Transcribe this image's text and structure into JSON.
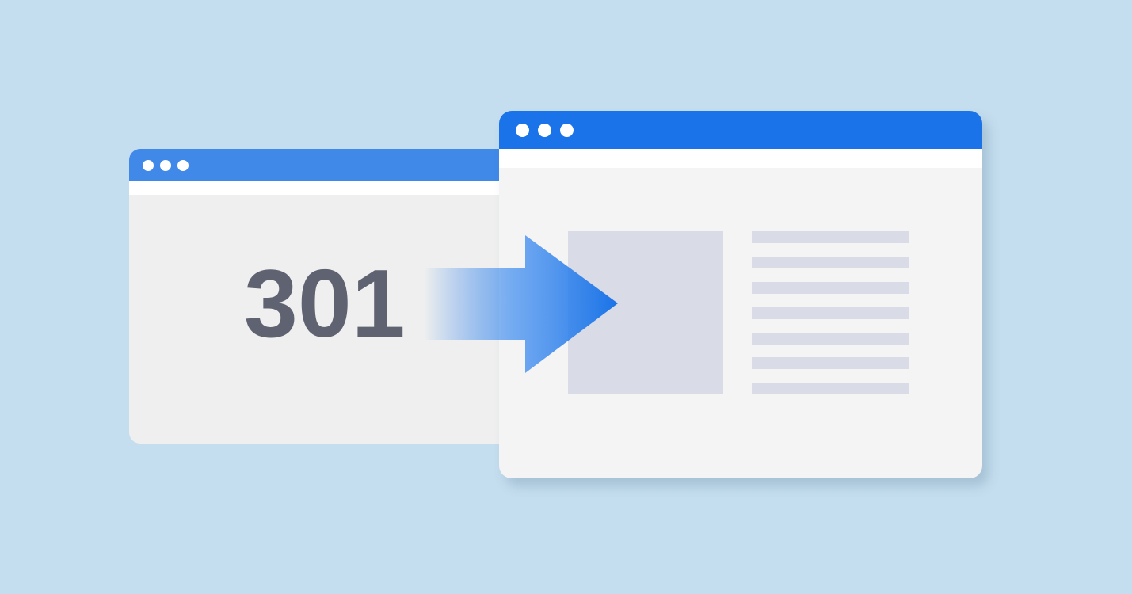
{
  "old_page": {
    "status_code": "301",
    "titlebar_color": "#4189e9"
  },
  "new_page": {
    "titlebar_color": "#1a73e8",
    "text_lines": 7
  },
  "arrow": {
    "icon": "redirect-arrow-icon",
    "color": "#1a73e8"
  }
}
